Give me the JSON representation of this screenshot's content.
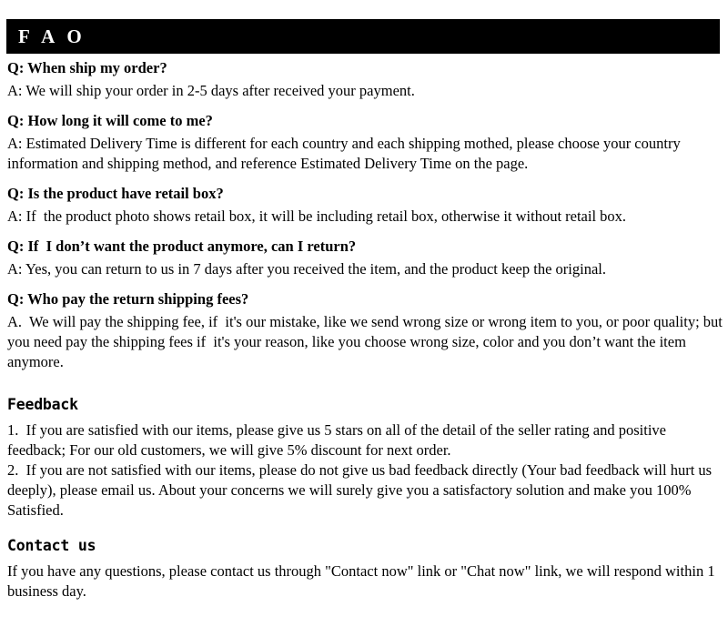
{
  "header": {
    "title": "F A O",
    "background_color": "#000000",
    "text_color": "#ffffff"
  },
  "faq": {
    "items": [
      {
        "question": "Q: When ship my order?",
        "answer": "A: We will ship your order in 2-5 days after received your payment."
      },
      {
        "question": "Q: How long it will come to me?",
        "answer": "A: Estimated Delivery Time is different for each country and each shipping mothed, please choose your country information and shipping method, and reference Estimated Delivery Time on the page."
      },
      {
        "question": "Q: Is the product have retail box?",
        "answer": "A: If  the product photo shows retail box, it will be including retail box, otherwise it without retail box."
      },
      {
        "question": "Q: If  I don’t want the product anymore, can I return?",
        "answer": "A: Yes, you can return to us in 7 days after you received the item, and the product keep the original."
      },
      {
        "question": "Q: Who pay the return shipping fees?",
        "answer": "A.  We will pay the shipping fee, if  it's our mistake, like we send wrong size or wrong item to you, or poor quality; but you need pay the shipping fees if  it's your reason, like you choose wrong size, color and you don’t want the item anymore."
      }
    ]
  },
  "feedback": {
    "heading": "Feedback",
    "item_1": "1.  If you are satisfied with our items, please give us 5 stars on all of the detail of the seller rating and positive feedback; For our old customers, we will give 5% discount for next order.",
    "item_2": "2.  If you are not satisfied with our items, please do not give us bad feedback directly (Your bad feedback will hurt us deeply), please email us. About your concerns we will surely give you a satisfactory solution and make you 100% Satisfied."
  },
  "contact": {
    "heading": "Contact us",
    "body": "If you have any questions, please contact us through \"Contact now\" link or \"Chat now\" link, we will respond within 1 business day."
  }
}
